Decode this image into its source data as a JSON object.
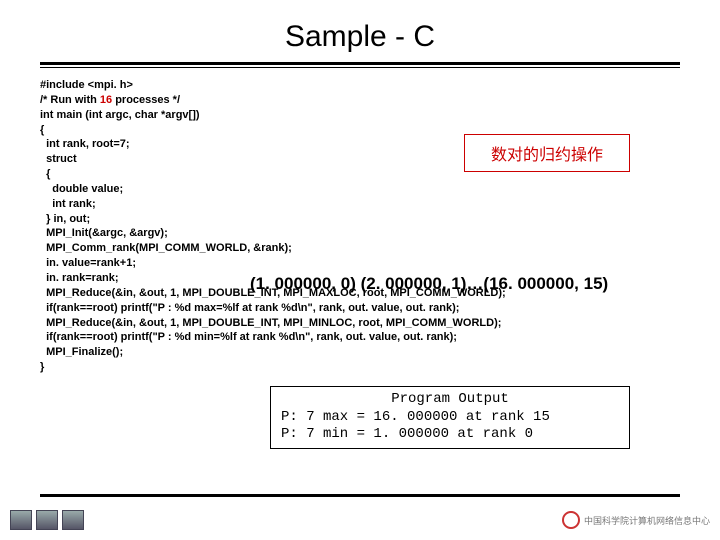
{
  "title": "Sample - C",
  "code": {
    "l01": "#include <mpi. h>",
    "l02a": "/* Run with ",
    "l02b": "16",
    "l02c": " processes */",
    "l03": "int main (int argc, char *argv[])",
    "l04": "{",
    "l05": "  int rank, root=7;",
    "l06": "  struct",
    "l07": "  {",
    "l08": "    double value;",
    "l09": "    int rank;",
    "l10": "  } in, out;",
    "l11": "  MPI_Init(&argc, &argv);",
    "l12": "  MPI_Comm_rank(MPI_COMM_WORLD, &rank);",
    "l13": "  in. value=rank+1;",
    "l14": "  in. rank=rank;",
    "l15": "  MPI_Reduce(&in, &out, 1, MPI_DOUBLE_INT, MPI_MAXLOC, root, MPI_COMM_WORLD);",
    "l16": "  if(rank==root) printf(\"P : %d max=%lf at rank %d\\n\", rank, out. value, out. rank);",
    "l17": "  MPI_Reduce(&in, &out, 1, MPI_DOUBLE_INT, MPI_MINLOC, root, MPI_COMM_WORLD);",
    "l18": "  if(rank==root) printf(\"P : %d min=%lf at rank %d\\n\", rank, out. value, out. rank);",
    "l19": "  MPI_Finalize();",
    "l20": "}"
  },
  "callout": "数对的归约操作",
  "series": "(1. 000000, 0) (2. 000000, 1)…(16. 000000, 15)",
  "output": {
    "title": "Program Output",
    "l1": "P: 7 max = 16. 000000 at rank 15",
    "l2": "P: 7 min = 1. 000000 at rank 0"
  },
  "footer_right": "中国科学院计算机网络信息中心"
}
